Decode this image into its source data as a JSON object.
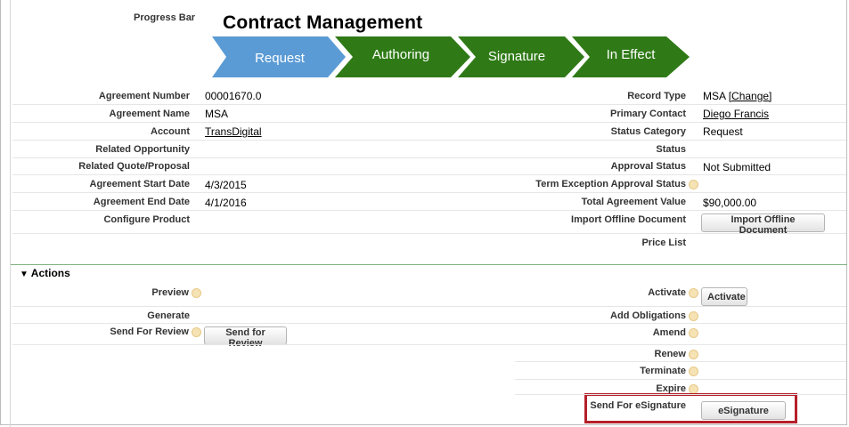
{
  "progress_bar": {
    "label": "Progress Bar",
    "title": "Contract Management",
    "stages": [
      {
        "label": "Request",
        "color": "#5b9bd5",
        "active": true
      },
      {
        "label": "Authoring",
        "color": "#2f7a16",
        "active": false
      },
      {
        "label": "Signature",
        "color": "#2f7a16",
        "active": false
      },
      {
        "label": "In Effect",
        "color": "#2f7a16",
        "active": false
      }
    ]
  },
  "details": {
    "left": [
      {
        "label": "Agreement Number",
        "value": "00001670.0"
      },
      {
        "label": "Agreement Name",
        "value": "MSA"
      },
      {
        "label": "Account",
        "value": "TransDigital"
      },
      {
        "label": "Related Opportunity",
        "value": ""
      },
      {
        "label": "Related Quote/Proposal",
        "value": ""
      },
      {
        "label": "Agreement Start Date",
        "value": "4/3/2015"
      },
      {
        "label": "Agreement End Date",
        "value": "4/1/2016"
      },
      {
        "label": "Configure Product",
        "value": ""
      }
    ],
    "right": [
      {
        "label": "Record Type",
        "value": "MSA",
        "link": "[Change]"
      },
      {
        "label": "Primary Contact",
        "value": "Diego Francis"
      },
      {
        "label": "Status Category",
        "value": "Request"
      },
      {
        "label": "Status",
        "value": ""
      },
      {
        "label": "Approval Status",
        "value": "Not Submitted"
      },
      {
        "label": "Term Exception Approval Status",
        "value": ""
      },
      {
        "label": "Total Agreement Value",
        "value": "$90,000.00"
      },
      {
        "label": "Import Offline Document",
        "button": "Import Offline Document"
      },
      {
        "label": "Price List",
        "value": ""
      }
    ]
  },
  "actions": {
    "header": "Actions",
    "left": [
      {
        "label": "Preview"
      },
      {
        "label": "Generate"
      },
      {
        "label": "Send For Review",
        "button": "Send for Review"
      }
    ],
    "right": [
      {
        "label": "Activate",
        "button": "Activate"
      },
      {
        "label": "Add Obligations"
      },
      {
        "label": "Amend"
      },
      {
        "label": "Renew"
      },
      {
        "label": "Terminate"
      },
      {
        "label": "Expire"
      },
      {
        "label": "Send For eSignature",
        "button": "eSignature"
      }
    ]
  },
  "colors": {
    "highlight": "#b5202b",
    "section_rule": "#7fb17f"
  },
  "icons": {
    "help": "help-icon",
    "toggle": "triangle-down-icon"
  }
}
